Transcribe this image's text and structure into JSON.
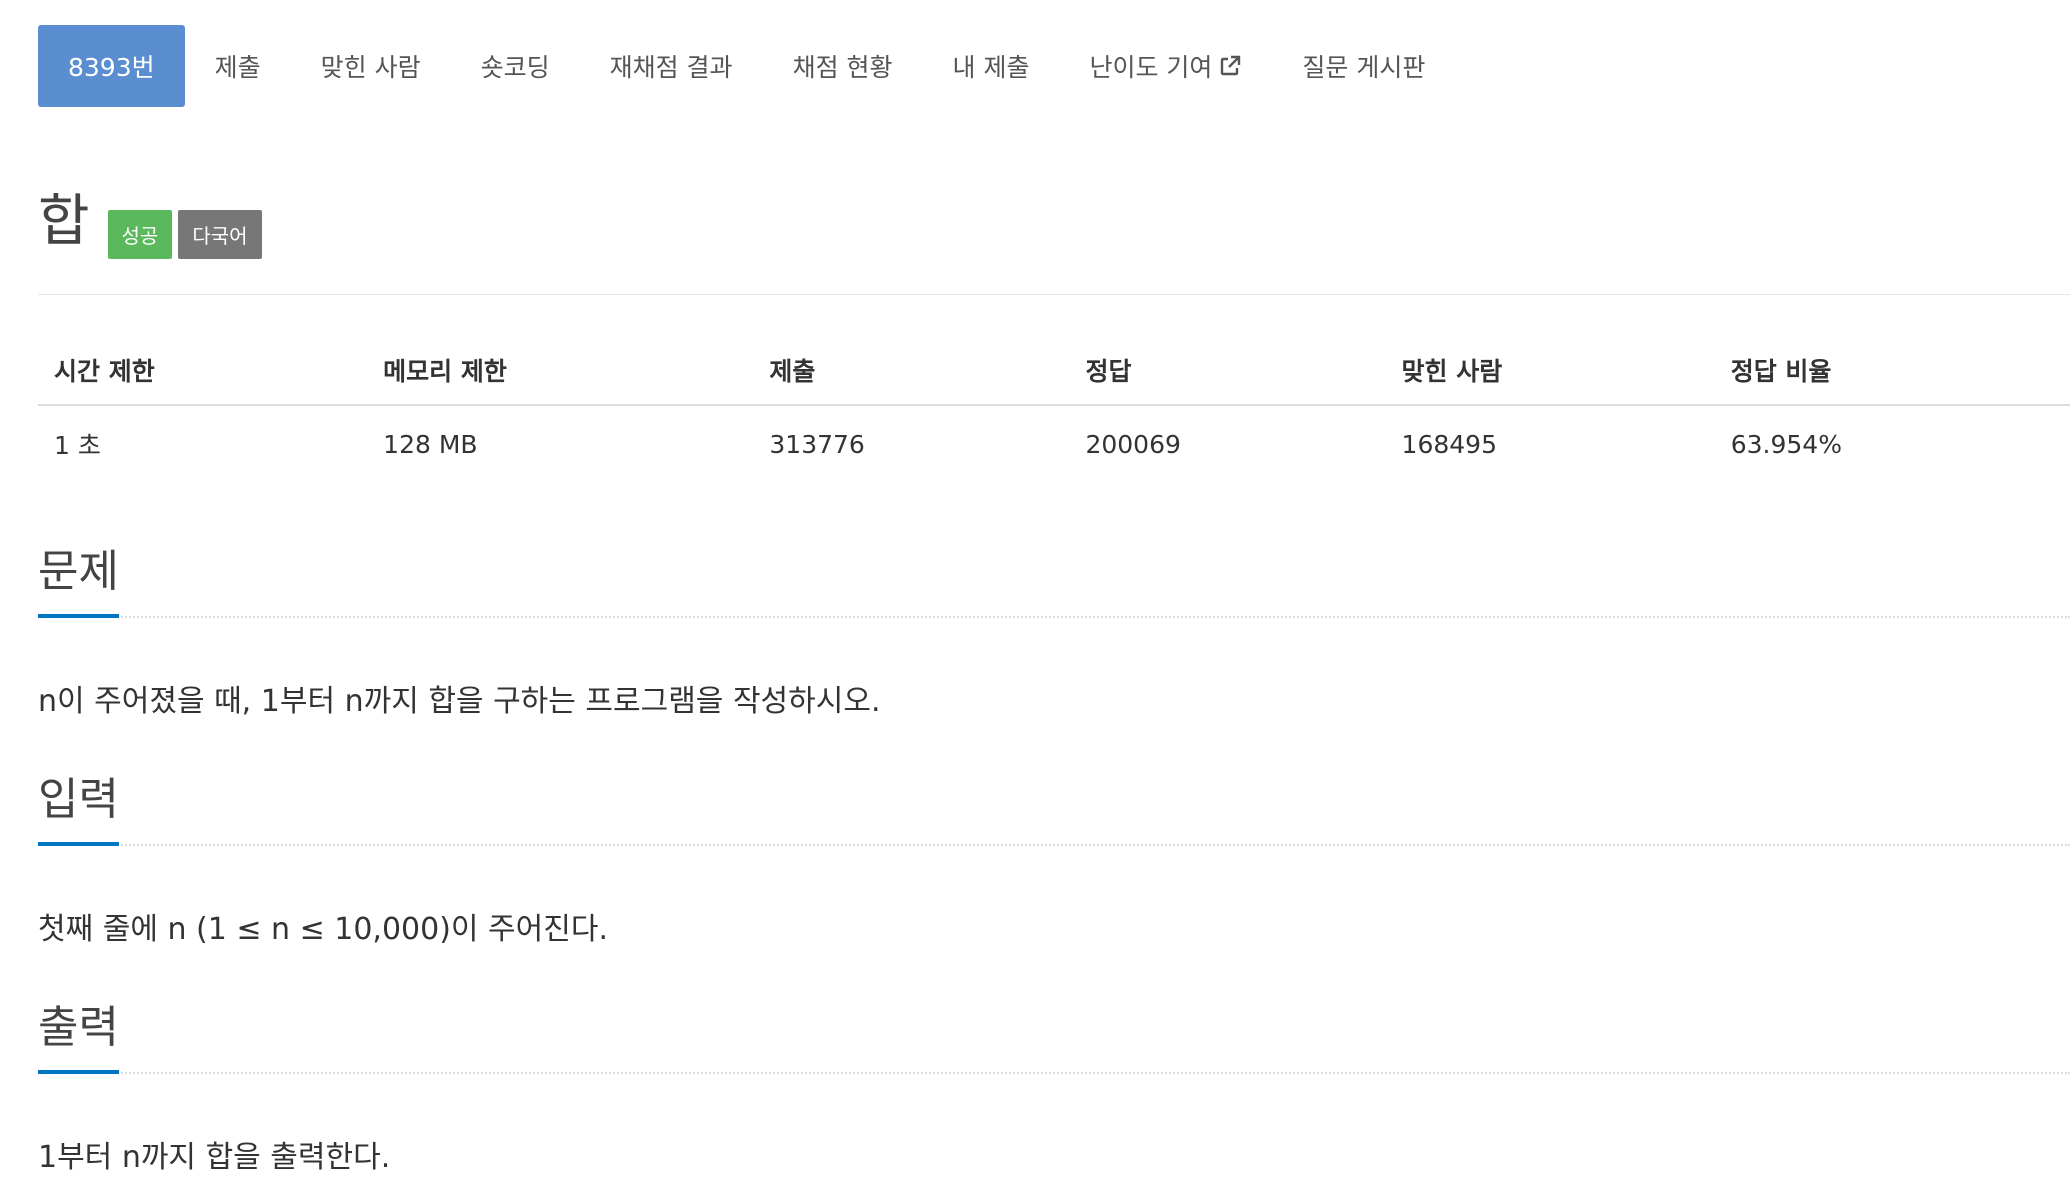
{
  "nav": {
    "tabs": [
      {
        "label": "8393번",
        "active": true
      },
      {
        "label": "제출"
      },
      {
        "label": "맞힌 사람"
      },
      {
        "label": "숏코딩"
      },
      {
        "label": "재채점 결과"
      },
      {
        "label": "채점 현황"
      },
      {
        "label": "내 제출"
      },
      {
        "label": "난이도 기여",
        "icon": "external-link-icon"
      },
      {
        "label": "질문 게시판"
      }
    ]
  },
  "problem": {
    "title": "합",
    "labels": [
      {
        "text": "성공",
        "color": "#5cb85c"
      },
      {
        "text": "다국어",
        "color": "#777777"
      }
    ]
  },
  "info": {
    "headers": [
      "시간 제한",
      "메모리 제한",
      "제출",
      "정답",
      "맞힌 사람",
      "정답 비율"
    ],
    "values": [
      "1 초",
      "128 MB",
      "313776",
      "200069",
      "168495",
      "63.954%"
    ]
  },
  "sections": {
    "description": {
      "title": "문제",
      "text": "n이 주어졌을 때, 1부터 n까지 합을 구하는 프로그램을 작성하시오."
    },
    "input": {
      "title": "입력",
      "text": "첫째 줄에 n (1 ≤ n ≤ 10,000)이 주어진다."
    },
    "output": {
      "title": "출력",
      "text": "1부터 n까지 합을 출력한다."
    }
  },
  "colors": {
    "active_tab": "#5a8ed0",
    "section_underline": "#0076c0",
    "success_label": "#5cb85c",
    "default_label": "#777777"
  }
}
